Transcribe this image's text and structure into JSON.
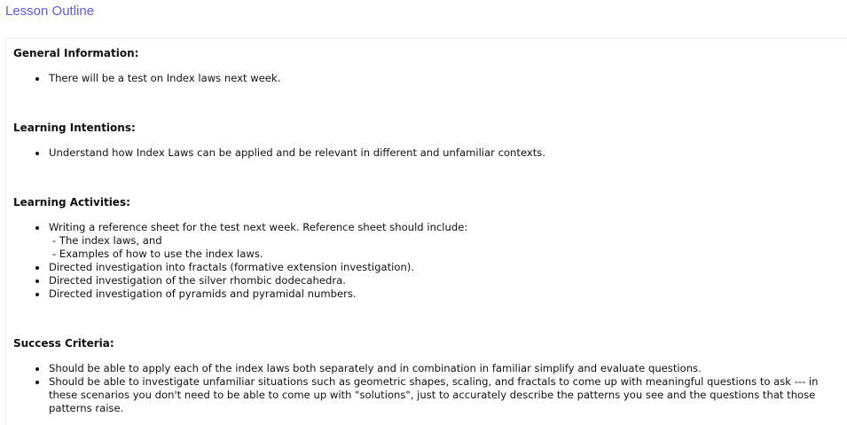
{
  "header": {
    "title": "Lesson Outline"
  },
  "colors": {
    "header_link": "#5b5bd6",
    "text": "#111111"
  },
  "sections": {
    "general": {
      "title": "General Information:",
      "items": [
        "There will be a test on Index laws next week."
      ]
    },
    "intentions": {
      "title": "Learning Intentions:",
      "items": [
        "Understand how Index Laws can be applied and be relevant in different and unfamiliar contexts."
      ]
    },
    "activities": {
      "title": "Learning Activities:",
      "item0": {
        "text": "Writing a reference sheet for the test next week. Reference sheet should include:",
        "sub": [
          "- The index laws, and",
          "- Examples of how to use the index laws."
        ]
      },
      "items": [
        "Directed investigation into fractals (formative extension investigation).",
        "Directed investigation of the silver rhombic dodecahedra.",
        "Directed investigation of pyramids and pyramidal numbers."
      ]
    },
    "success": {
      "title": "Success Criteria:",
      "items": [
        "Should be able to apply each of the index laws both separately and in combination in familiar simplify and evaluate questions.",
        "Should be able to investigate unfamiliar situations such as geometric shapes, scaling, and fractals to come up with meaningful questions to ask --- in these scenarios you don't need to be able to come up with \"solutions\", just to accurately describe the patterns you see and the questions that those patterns raise."
      ]
    }
  }
}
